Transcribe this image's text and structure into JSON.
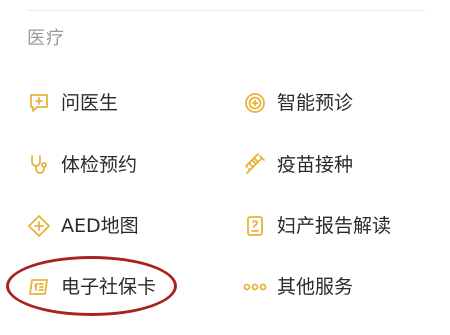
{
  "section": {
    "title": "医疗"
  },
  "items": [
    {
      "label": "问医生",
      "icon": "chat-doctor-icon"
    },
    {
      "label": "智能预诊",
      "icon": "smart-diagnosis-icon"
    },
    {
      "label": "体检预约",
      "icon": "stethoscope-icon"
    },
    {
      "label": "疫苗接种",
      "icon": "syringe-icon"
    },
    {
      "label": "AED地图",
      "icon": "aed-map-icon"
    },
    {
      "label": "妇产报告解读",
      "icon": "report-icon"
    },
    {
      "label": "电子社保卡",
      "icon": "social-security-card-icon"
    },
    {
      "label": "其他服务",
      "icon": "more-dots-icon"
    }
  ],
  "colors": {
    "icon_accent": "#e8b23a",
    "highlight": "#a8231f",
    "text": "#2b2b2b",
    "muted": "#9a9a9a"
  }
}
